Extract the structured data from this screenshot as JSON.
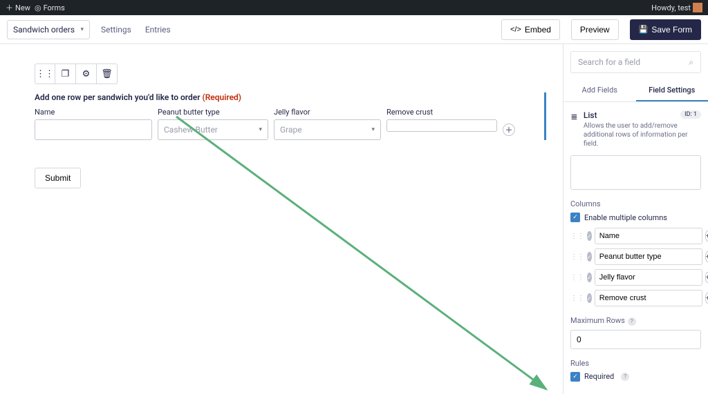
{
  "topbar": {
    "new": "New",
    "forms": "Forms",
    "greeting": "Howdy, test"
  },
  "header": {
    "form_name": "Sandwich orders",
    "tabs": {
      "settings": "Settings",
      "entries": "Entries"
    },
    "embed": "Embed",
    "preview": "Preview",
    "save": "Save Form"
  },
  "canvas": {
    "field_label": "Add one row per sandwich you'd like to order",
    "required_tag": "(Required)",
    "columns": {
      "name": {
        "label": "Name"
      },
      "pb": {
        "label": "Peanut butter type",
        "placeholder": "Cashew Butter"
      },
      "jelly": {
        "label": "Jelly flavor",
        "placeholder": "Grape"
      },
      "crust": {
        "label": "Remove crust"
      }
    },
    "submit": "Submit"
  },
  "sidebar": {
    "search_placeholder": "Search for a field",
    "tabs": {
      "add": "Add Fields",
      "settings": "Field Settings"
    },
    "field": {
      "title": "List",
      "desc": "Allows the user to add/remove additional rows of information per field.",
      "id_badge": "ID: 1"
    },
    "columns_label": "Columns",
    "enable_multi": "Enable multiple columns",
    "cols": [
      "Name",
      "Peanut butter type",
      "Jelly flavor",
      "Remove crust"
    ],
    "max_rows_label": "Maximum Rows",
    "max_rows_value": "0",
    "rules_label": "Rules",
    "required_label": "Required"
  }
}
